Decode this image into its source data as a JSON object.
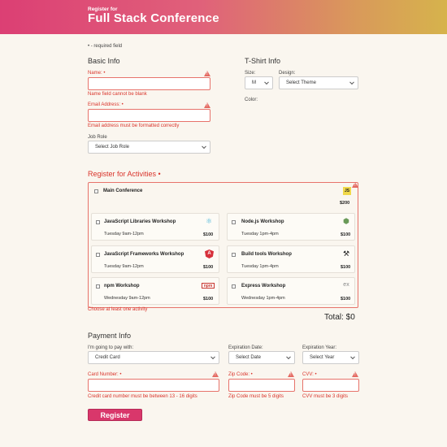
{
  "header": {
    "subtitle": "Register for",
    "title": "Full Stack Conference"
  },
  "required_note": "• - required field",
  "basic_info": {
    "heading": "Basic Info",
    "name_label": "Name: •",
    "name_error": "Name field cannot be blank",
    "email_label": "Email Address: •",
    "email_error": "Email address must be formatted correctly",
    "job_role_label": "Job Role",
    "job_role_value": "Select Job Role"
  },
  "tshirt": {
    "heading": "T-Shirt Info",
    "size_label": "Size:",
    "size_value": "M",
    "design_label": "Design:",
    "design_value": "Select Theme",
    "color_label": "Color:"
  },
  "activities": {
    "heading": "Register for Activities •",
    "main": {
      "name": "Main Conference",
      "price": "$200",
      "icon": "js-icon",
      "icon_text": "JS"
    },
    "items": [
      {
        "name": "JavaScript Libraries Workshop",
        "time": "Tuesday 9am-12pm",
        "price": "$100",
        "icon": "react-icon",
        "icon_text": "⚛"
      },
      {
        "name": "Node.js Workshop",
        "time": "Tuesday 1pm-4pm",
        "price": "$100",
        "icon": "node-icon",
        "icon_text": "⬢"
      },
      {
        "name": "JavaScript Frameworks Workshop",
        "time": "Tuesday 9am-12pm",
        "price": "$100",
        "icon": "angular-icon",
        "icon_text": "A"
      },
      {
        "name": "Build tools Workshop",
        "time": "Tuesday 1pm-4pm",
        "price": "$100",
        "icon": "tools-icon",
        "icon_text": "⚒"
      },
      {
        "name": "npm Workshop",
        "time": "Wednesday 9am-12pm",
        "price": "$100",
        "icon": "npm-icon",
        "icon_text": "npm"
      },
      {
        "name": "Express Workshop",
        "time": "Wednesday 1pm-4pm",
        "price": "$100",
        "icon": "express-icon",
        "icon_text": "ex"
      }
    ],
    "error": "Choose at least one activity",
    "total": "Total: $0"
  },
  "payment": {
    "heading": "Payment Info",
    "pay_with_label": "I'm going to pay with:",
    "pay_with_value": "Credit Card",
    "exp_date_label": "Expiration Date:",
    "exp_date_value": "Select Date",
    "exp_year_label": "Expiration Year:",
    "exp_year_value": "Select Year",
    "card_label": "Card Number: •",
    "card_error": "Credit card number must be between 13 - 16 digits",
    "zip_label": "Zip Code: •",
    "zip_error": "Zip Code must be 5 digits",
    "cvv_label": "CVV: •",
    "cvv_error": "CVV must be 3 digits"
  },
  "register_button": "Register",
  "colors": {
    "accent": "#d9376b",
    "error": "#d9342b",
    "background": "#faf6ef"
  }
}
